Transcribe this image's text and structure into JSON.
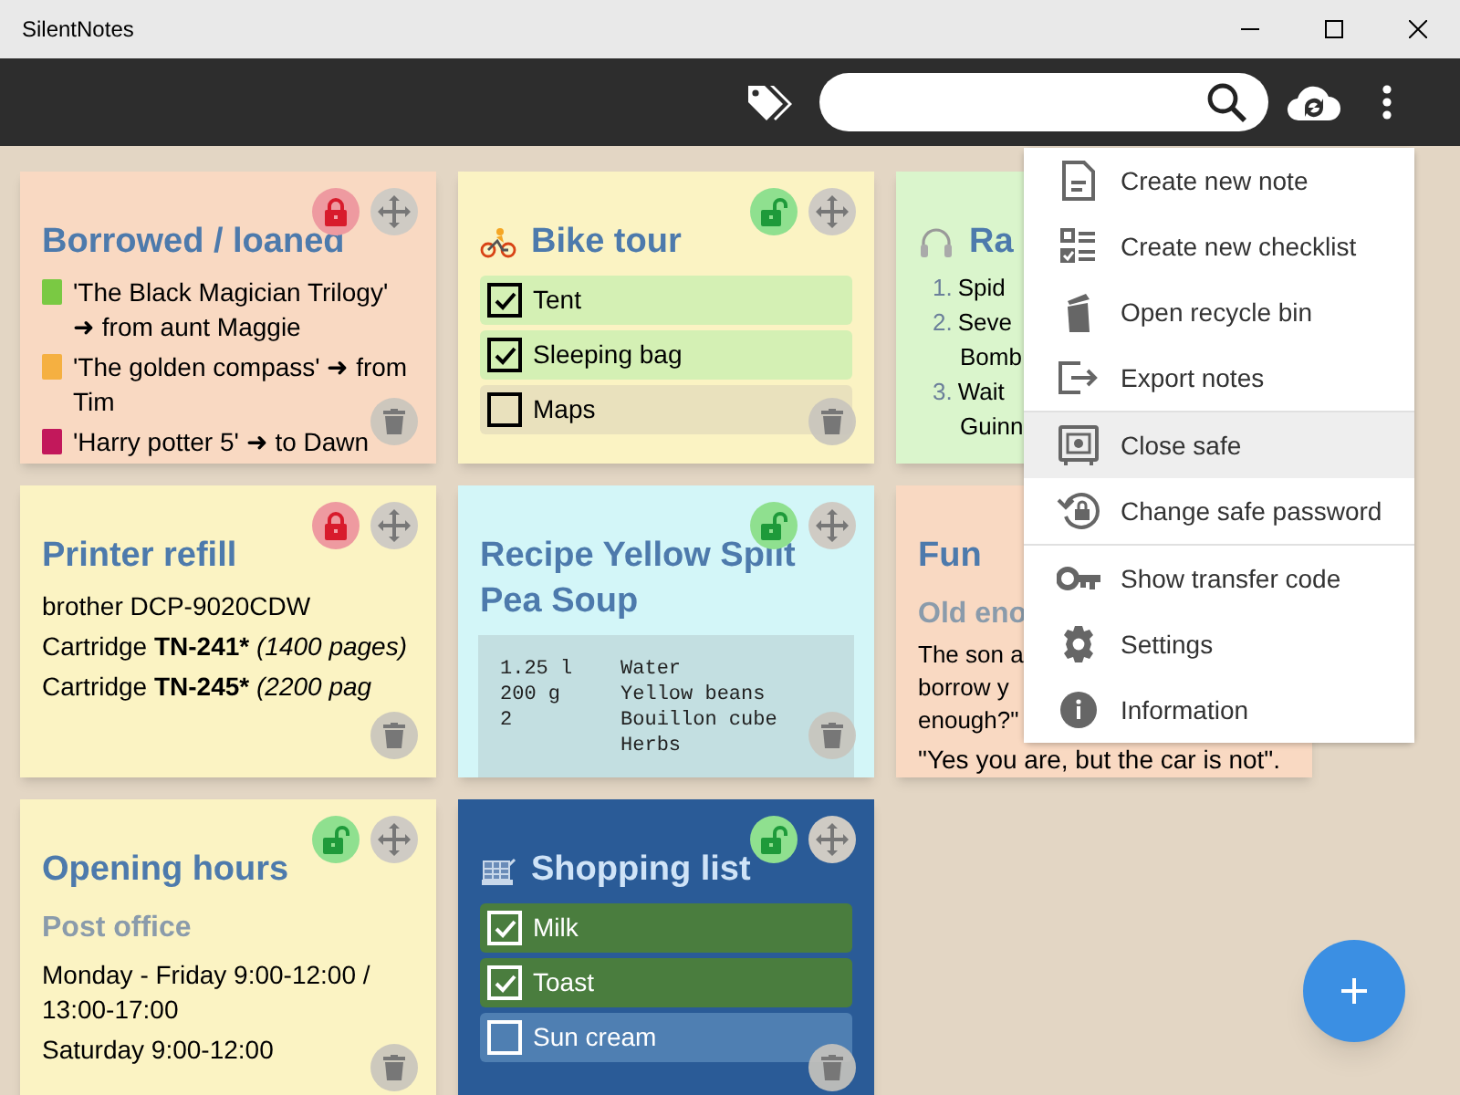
{
  "window": {
    "title": "SilentNotes"
  },
  "notes": [
    {
      "title": "Borrowed / loaned",
      "color": "#f9d9c2",
      "locked": true,
      "blocks": [
        {
          "kind": "text",
          "text": "'The Black Magician Trilogy' ➜ from aunt Maggie",
          "color": "#7ac943"
        },
        {
          "kind": "text",
          "text": "'The golden compass' ➜ from Tim",
          "color": "#f5b041"
        },
        {
          "kind": "text",
          "text": "'Harry potter 5' ➜ to Dawn",
          "color": "#c2185b"
        }
      ]
    },
    {
      "title": "Bike tour",
      "color": "#fbf3c3",
      "locked": false,
      "blocks": [
        {
          "kind": "check",
          "text": "Tent",
          "checked": true
        },
        {
          "kind": "check",
          "text": "Sleeping bag",
          "checked": true
        },
        {
          "kind": "check",
          "text": "Maps",
          "checked": false
        }
      ]
    },
    {
      "title": "Ra",
      "color": "#daf5cc",
      "blocks": [
        {
          "kind": "numbered",
          "number": "1.",
          "text": "Spid"
        },
        {
          "kind": "numbered",
          "number": "2.",
          "text": "Seve"
        },
        {
          "kind": "indented",
          "text": "Bomb"
        },
        {
          "kind": "numbered",
          "number": "3.",
          "text": "Wait"
        },
        {
          "kind": "indented",
          "text": "Guinn"
        }
      ]
    },
    {
      "title": "Printer refill",
      "color": "#fbf3c3",
      "locked": true,
      "blocks": [
        {
          "kind": "text",
          "text": "brother DCP-9020CDW"
        },
        {
          "kind": "cartridge",
          "label": "Cartridge",
          "model": "TN-241*",
          "pages": "(1400 pages)"
        },
        {
          "kind": "cartridge",
          "label": "Cartridge",
          "model": "TN-245*",
          "pages": "(2200 pag"
        }
      ]
    },
    {
      "title": "Recipe Yellow Split Pea Soup",
      "color": "#d3f6f8",
      "locked": false,
      "blocks": [
        {
          "kind": "code",
          "text": "1.25 l    Water\n200 g     Yellow beans\n2         Bouillon cube\n          Herbs"
        }
      ]
    },
    {
      "title": "Fun",
      "color": "#f9d9c2",
      "blocks": [
        {
          "kind": "subheading",
          "text": "Old eno"
        },
        {
          "kind": "short",
          "text": "The son a"
        },
        {
          "kind": "short",
          "text": "borrow y"
        },
        {
          "kind": "short",
          "text": "enough?\""
        },
        {
          "kind": "text",
          "text": "\"Yes you are, but the car is not\"."
        }
      ]
    },
    {
      "title": "Opening hours",
      "color": "#fbf3c3",
      "locked": false,
      "blocks": [
        {
          "kind": "subheading",
          "text": "Post office"
        },
        {
          "kind": "text",
          "text": "Monday - Friday 9:00-12:00 / 13:00-17:00"
        },
        {
          "kind": "text",
          "text": "Saturday 9:00-12:00"
        }
      ]
    },
    {
      "title": "Shopping list",
      "color": "#2a5b97",
      "dark": true,
      "locked": false,
      "blocks": [
        {
          "kind": "check",
          "text": "Milk",
          "checked": true
        },
        {
          "kind": "check",
          "text": "Toast",
          "checked": true
        },
        {
          "kind": "check",
          "text": "Sun cream",
          "checked": false
        }
      ]
    }
  ],
  "menu": {
    "sections": [
      [
        {
          "label": "Create new note",
          "selected": false
        },
        {
          "label": "Create new checklist",
          "selected": false
        },
        {
          "label": "Open recycle bin",
          "selected": false
        },
        {
          "label": "Export notes",
          "selected": false
        }
      ],
      [
        {
          "label": "Close safe",
          "selected": true
        },
        {
          "label": "Change safe password",
          "selected": false
        }
      ],
      [
        {
          "label": "Show transfer code",
          "selected": false
        },
        {
          "label": "Settings",
          "selected": false
        },
        {
          "label": "Information",
          "selected": false
        }
      ]
    ]
  }
}
